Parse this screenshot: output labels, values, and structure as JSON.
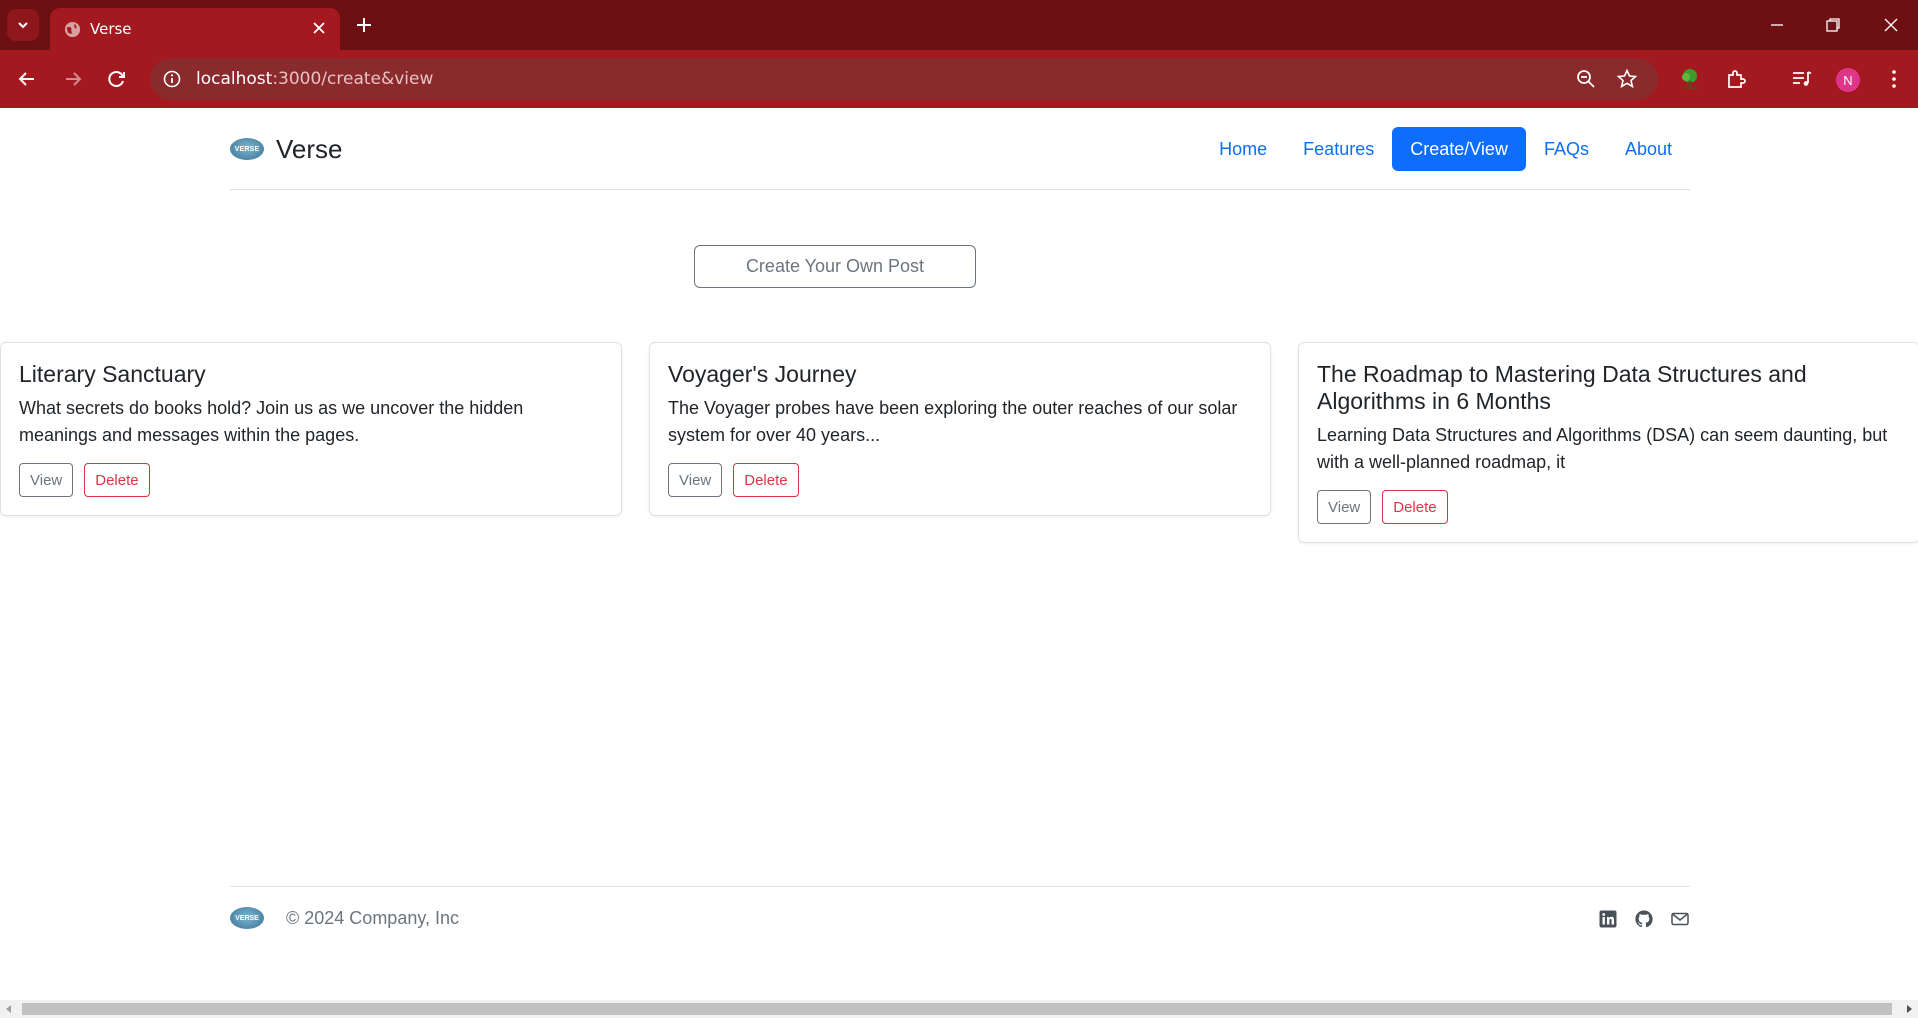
{
  "browser": {
    "tab_title": "Verse",
    "url_host": "localhost",
    "url_path": ":3000/create&view",
    "profile_initial": "N"
  },
  "header": {
    "logo_text": "VERSE",
    "brand": "Verse",
    "nav": [
      {
        "label": "Home",
        "active": false
      },
      {
        "label": "Features",
        "active": false
      },
      {
        "label": "Create/View",
        "active": true
      },
      {
        "label": "FAQs",
        "active": false
      },
      {
        "label": "About",
        "active": false
      }
    ]
  },
  "main": {
    "create_button": "Create Your Own Post",
    "posts": [
      {
        "title": "Literary Sanctuary",
        "excerpt": "What secrets do books hold? Join us as we uncover the hidden meanings and messages within the pages.",
        "view_label": "View",
        "delete_label": "Delete"
      },
      {
        "title": "Voyager's Journey",
        "excerpt": "The Voyager probes have been exploring the outer reaches of our solar system for over 40 years...",
        "view_label": "View",
        "delete_label": "Delete"
      },
      {
        "title": "The Roadmap to Mastering Data Structures and Algorithms in 6 Months",
        "excerpt": "Learning Data Structures and Algorithms (DSA) can seem daunting, but with a well-planned roadmap, it",
        "view_label": "View",
        "delete_label": "Delete"
      }
    ]
  },
  "footer": {
    "logo_text": "VERSE",
    "copyright": "© 2024 Company, Inc",
    "icons": [
      "linkedin-icon",
      "github-icon",
      "mail-icon"
    ]
  },
  "colors": {
    "tabbar": "#6c1014",
    "toolbar": "#a4191f",
    "primary": "#0d6efd",
    "danger": "#dc3545",
    "secondary": "#6c757d"
  }
}
